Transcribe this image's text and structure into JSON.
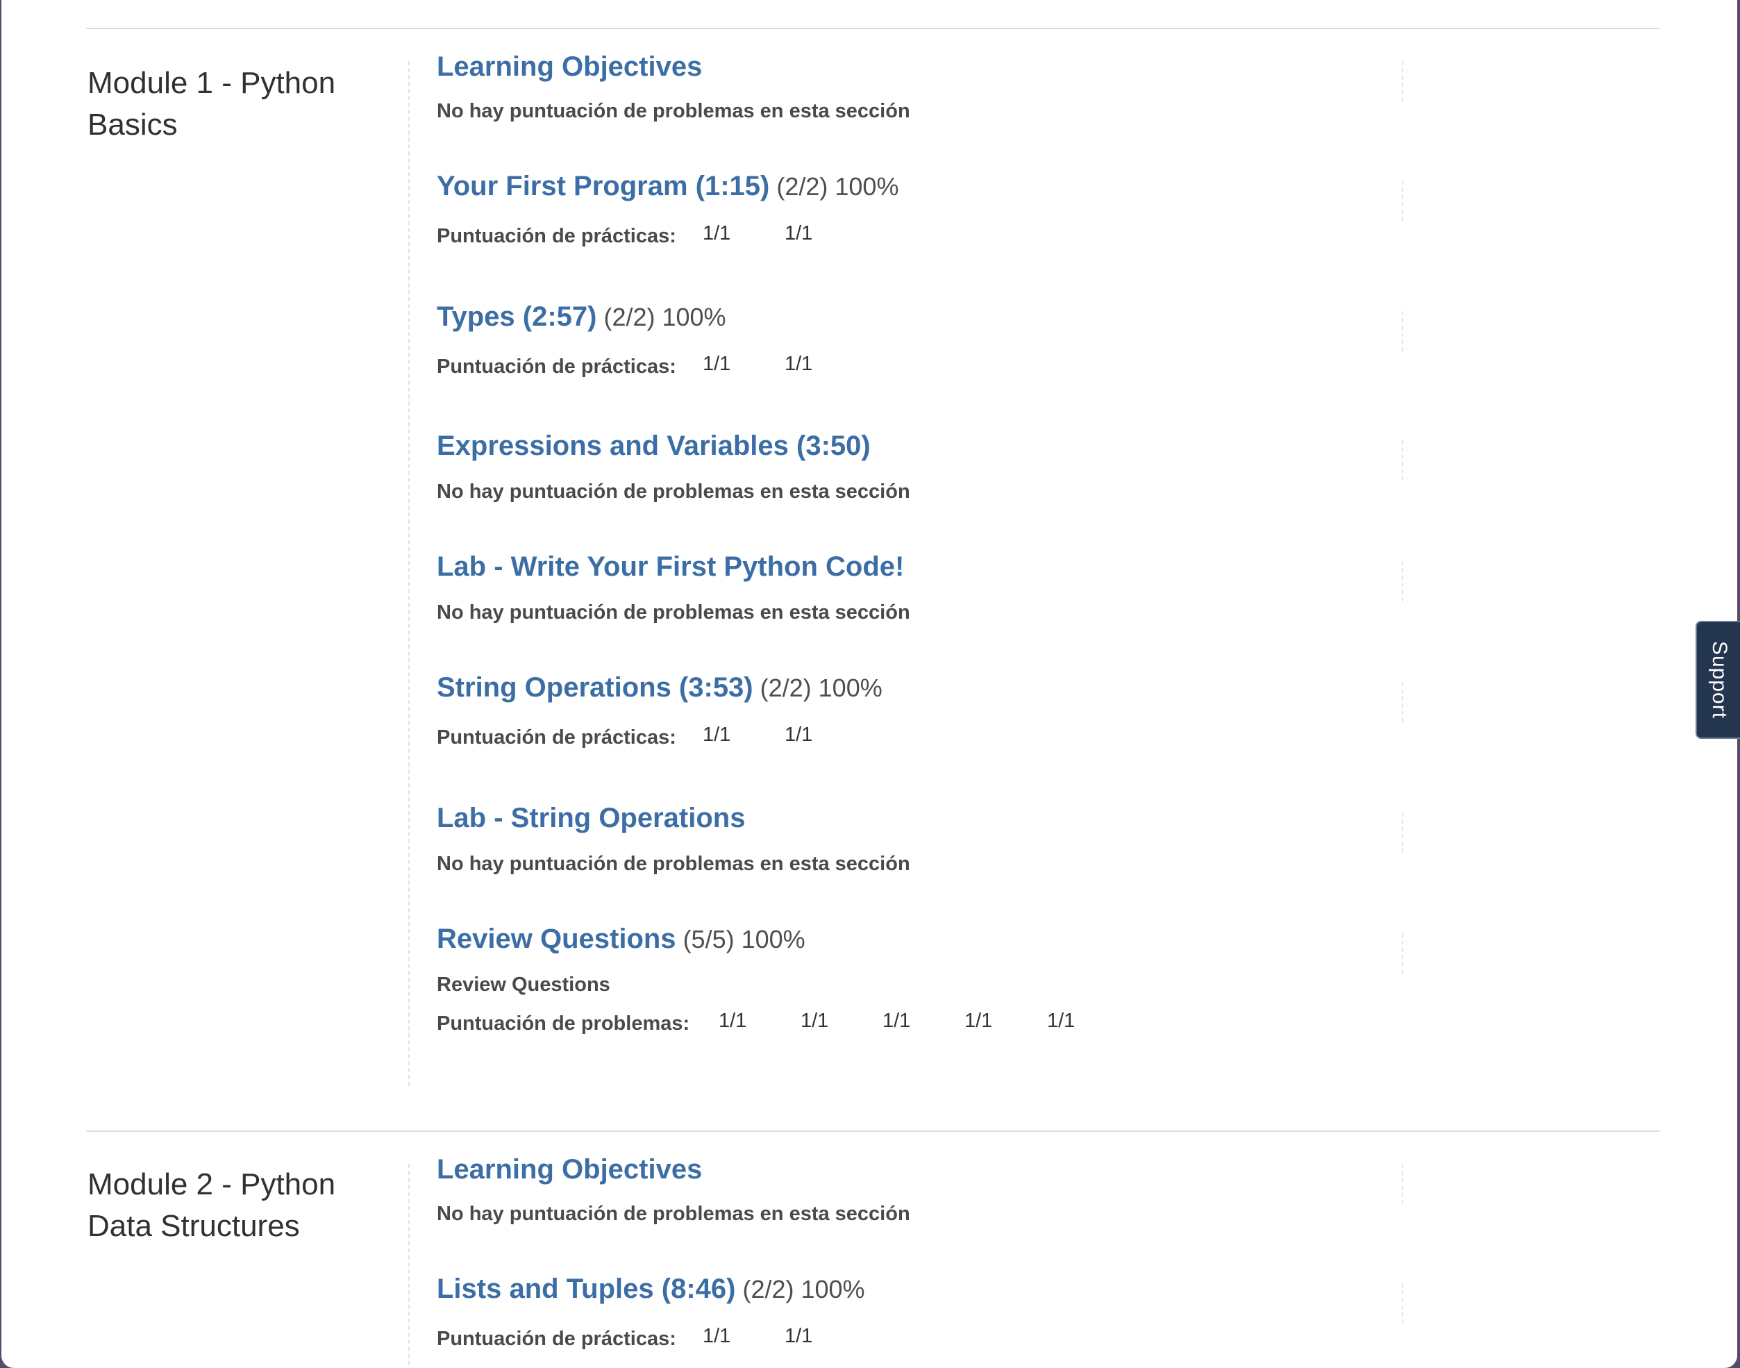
{
  "support_label": "Support",
  "chapters": [
    {
      "title": "Module 1 - Python Basics",
      "sections": [
        {
          "title": "Learning Objectives",
          "note": "No hay puntuación de problemas en esta sección"
        },
        {
          "title": "Your First Program (1:15)",
          "score": "(2/2) 100%",
          "scores_label": "Puntuación de prácticas:",
          "scores": [
            "1/1",
            "1/1"
          ]
        },
        {
          "title": "Types (2:57)",
          "score": "(2/2) 100%",
          "scores_label": "Puntuación de prácticas:",
          "scores": [
            "1/1",
            "1/1"
          ]
        },
        {
          "title": "Expressions and Variables (3:50)",
          "note": "No hay puntuación de problemas en esta sección"
        },
        {
          "title": "Lab - Write Your First Python Code!",
          "note": "No hay puntuación de problemas en esta sección"
        },
        {
          "title": "String Operations (3:53)",
          "score": "(2/2) 100%",
          "scores_label": "Puntuación de prácticas:",
          "scores": [
            "1/1",
            "1/1"
          ]
        },
        {
          "title": "Lab - String Operations",
          "note": "No hay puntuación de problemas en esta sección"
        },
        {
          "title": "Review Questions",
          "score": "(5/5) 100%",
          "note": "Review Questions",
          "scores_label": "Puntuación de problemas:",
          "scores": [
            "1/1",
            "1/1",
            "1/1",
            "1/1",
            "1/1"
          ]
        }
      ]
    },
    {
      "title": "Module 2 - Python Data Structures",
      "sections": [
        {
          "title": "Learning Objectives",
          "note": "No hay puntuación de problemas en esta sección"
        },
        {
          "title": "Lists and Tuples (8:46)",
          "score": "(2/2) 100%",
          "scores_label": "Puntuación de prácticas:",
          "scores": [
            "1/1",
            "1/1"
          ]
        }
      ]
    }
  ]
}
